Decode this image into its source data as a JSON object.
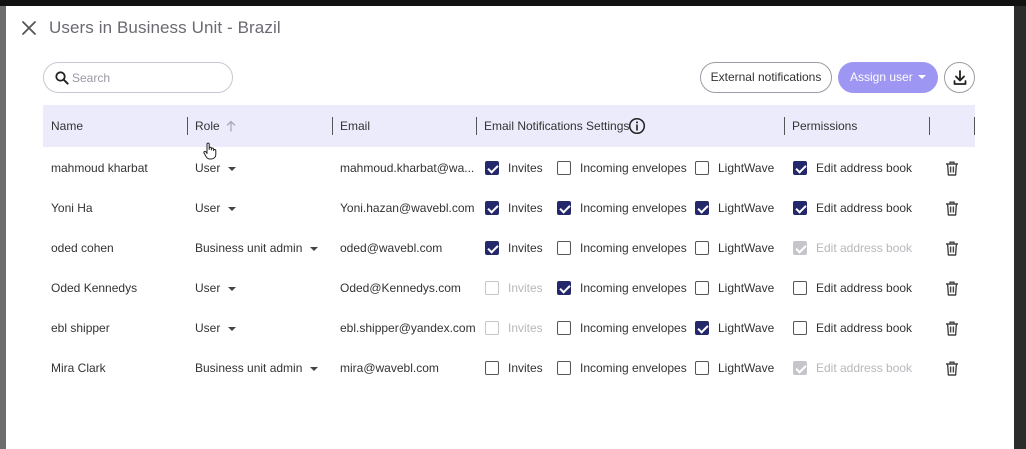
{
  "title": "Users in Business Unit - Brazil",
  "search": {
    "placeholder": "Search"
  },
  "buttons": {
    "external": "External notifications",
    "assign": "Assign user"
  },
  "columns": {
    "name": "Name",
    "role": "Role",
    "email": "Email",
    "notifications": "Email Notifications Settings",
    "permissions": "Permissions"
  },
  "colors": {
    "accent": "#9d96f2",
    "header_bg": "#ecebfb",
    "checked": "#24286a"
  },
  "rows": [
    {
      "name": "mahmoud kharbat",
      "role": "User",
      "email": "mahmoud.kharbat@wa...",
      "invites": "Invites",
      "incoming": "Incoming envelopes",
      "lightwave": "LightWave",
      "edit": "Edit address book"
    },
    {
      "name": "Yoni Ha",
      "role": "User",
      "email": "Yoni.hazan@wavebl.com",
      "invites": "Invites",
      "incoming": "Incoming envelopes",
      "lightwave": "LightWave",
      "edit": "Edit address book"
    },
    {
      "name": "oded cohen",
      "role": "Business unit admin",
      "email": "oded@wavebl.com",
      "invites": "Invites",
      "incoming": "Incoming envelopes",
      "lightwave": "LightWave",
      "edit": "Edit address book"
    },
    {
      "name": "Oded Kennedys",
      "role": "User",
      "email": "Oded@Kennedys.com",
      "invites": "Invites",
      "incoming": "Incoming envelopes",
      "lightwave": "LightWave",
      "edit": "Edit address book"
    },
    {
      "name": "ebl shipper",
      "role": "User",
      "email": "ebl.shipper@yandex.com",
      "invites": "Invites",
      "incoming": "Incoming envelopes",
      "lightwave": "LightWave",
      "edit": "Edit address book"
    },
    {
      "name": "Mira Clark",
      "role": "Business unit admin",
      "email": "mira@wavebl.com",
      "invites": "Invites",
      "incoming": "Incoming envelopes",
      "lightwave": "LightWave",
      "edit": "Edit address book"
    }
  ],
  "checkbox_states": [
    {
      "invites": "checked",
      "incoming": "unchecked",
      "lightwave": "unchecked",
      "edit": "checked"
    },
    {
      "invites": "checked",
      "incoming": "checked",
      "lightwave": "checked",
      "edit": "checked"
    },
    {
      "invites": "checked",
      "incoming": "unchecked",
      "lightwave": "unchecked",
      "edit": "checked-disabled"
    },
    {
      "invites": "unchecked-disabled",
      "incoming": "checked",
      "lightwave": "unchecked",
      "edit": "unchecked"
    },
    {
      "invites": "unchecked-disabled",
      "incoming": "unchecked",
      "lightwave": "checked",
      "edit": "unchecked"
    },
    {
      "invites": "unchecked",
      "incoming": "unchecked",
      "lightwave": "unchecked",
      "edit": "checked-disabled"
    }
  ]
}
